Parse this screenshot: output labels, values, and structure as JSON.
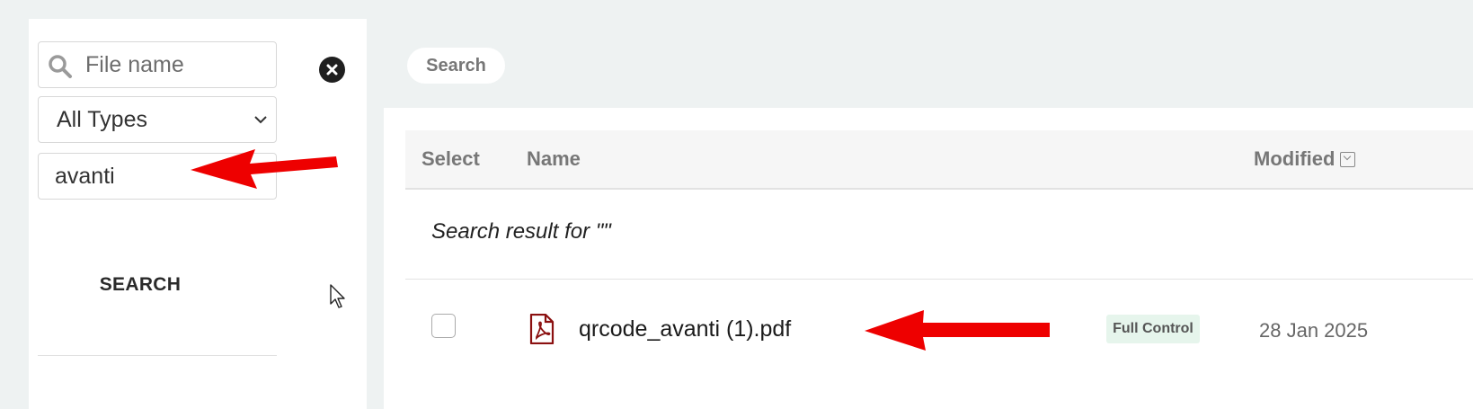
{
  "sidebar": {
    "search_placeholder": "File name",
    "type_select_value": "All Types",
    "keyword_value": "avanti",
    "search_button_label": "SEARCH"
  },
  "breadcrumb": {
    "label": "Search"
  },
  "table": {
    "columns": {
      "select": "Select",
      "name": "Name",
      "modified": "Modified"
    },
    "result_note": "Search result for \"\"",
    "rows": [
      {
        "name": "qrcode_avanti (1).pdf",
        "permission": "Full Control",
        "modified": "28 Jan 2025"
      }
    ]
  },
  "colors": {
    "annotation_arrow": "#ee0000",
    "pdf_icon": "#8b1010",
    "badge_bg": "#e6f5ec"
  },
  "icons": [
    "search-icon",
    "clear-icon",
    "chevron-down-icon",
    "sort-icon",
    "pdf-icon",
    "mouse-cursor"
  ]
}
